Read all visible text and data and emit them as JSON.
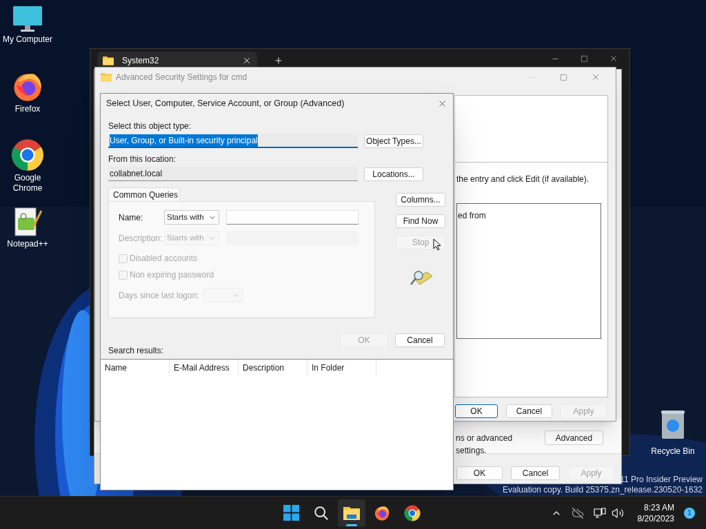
{
  "desktop": {
    "icons": [
      {
        "kind": "computer",
        "label": "My Computer"
      },
      {
        "kind": "firefox",
        "label": "Firefox"
      },
      {
        "kind": "chrome",
        "label": "Google Chrome"
      },
      {
        "kind": "notepad",
        "label": "Notepad++"
      }
    ],
    "recycle_bin": {
      "label": "Recycle Bin"
    },
    "watermark": [
      "11 Pro Insider Preview",
      "Evaluation copy. Build 25375.zn_release.230520-1632"
    ]
  },
  "explorer": {
    "tab": "System32"
  },
  "properties": {
    "note": "ns or advanced settings.",
    "advanced_button": "Advanced",
    "buttons": [
      {
        "label": "OK",
        "disabled": false,
        "default": false
      },
      {
        "label": "Cancel",
        "disabled": false,
        "default": false
      },
      {
        "label": "Apply",
        "disabled": true,
        "default": false
      }
    ]
  },
  "security": {
    "title": "Advanced Security Settings for cmd",
    "hint": "the entry and click Edit (if available).",
    "list_column": "ed from",
    "buttons": [
      {
        "label": "OK",
        "disabled": false,
        "default": true
      },
      {
        "label": "Cancel",
        "disabled": false,
        "default": false
      },
      {
        "label": "Apply",
        "disabled": true,
        "default": false
      }
    ]
  },
  "dialog": {
    "title": "Select User, Computer, Service Account, or Group (Advanced)",
    "object_type_label": "Select this object type:",
    "object_type": {
      "value": "User, Group, or Built-in security principal",
      "selected": true
    },
    "object_types_button": "Object Types...",
    "location_label": "From this location:",
    "location": "collabnet.local",
    "locations_button": "Locations...",
    "tab": {
      "label": "Common Queries",
      "selected": true
    },
    "name": {
      "label": "Name:",
      "mode": "Starts with",
      "disabled": false
    },
    "description": {
      "label": "Description:",
      "mode": "Starts with",
      "disabled": true
    },
    "checkboxes": [
      {
        "label": "Disabled accounts",
        "checked": false,
        "disabled": true
      },
      {
        "label": "Non expiring password",
        "checked": false,
        "disabled": true
      }
    ],
    "days_label": "Days since last logon:",
    "days_disabled": true,
    "side_buttons": [
      {
        "label": "Columns...",
        "disabled": false
      },
      {
        "label": "Find Now",
        "disabled": false
      },
      {
        "label": "Stop",
        "disabled": true
      }
    ],
    "ok": {
      "label": "OK",
      "disabled": true
    },
    "cancel": {
      "label": "Cancel",
      "disabled": false
    },
    "results_label": "Search results:",
    "columns": [
      "Name",
      "E-Mail Address",
      "Description",
      "In Folder"
    ]
  },
  "taskbar": {
    "apps": [
      {
        "kind": "start",
        "selected": false
      },
      {
        "kind": "search",
        "selected": false
      },
      {
        "kind": "explorer",
        "selected": true
      },
      {
        "kind": "firefox",
        "selected": false
      },
      {
        "kind": "chrome",
        "selected": false
      }
    ],
    "time": "8:23 AM",
    "date": "8/20/2023",
    "notifications": "1"
  }
}
